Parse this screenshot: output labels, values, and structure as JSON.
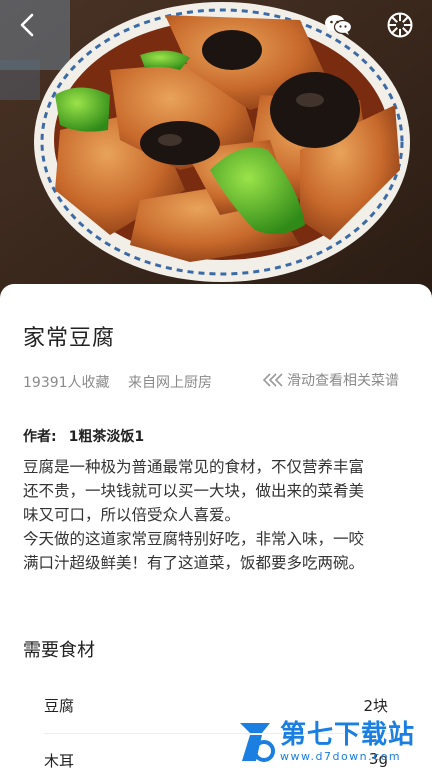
{
  "header": {
    "back_icon": "chevron-left-icon",
    "share_wechat_icon": "wechat-icon",
    "share_moments_icon": "moments-icon"
  },
  "recipe": {
    "title": "家常豆腐",
    "favorites": "19391人收藏",
    "source": "来自网上厨房",
    "swipe_hint": "滑动查看相关菜谱",
    "author_label": "作者:",
    "author_name": "1粗茶淡饭1",
    "description_lines": [
      "豆腐是一种极为普通最常见的食材，不仅营养丰富",
      "还不贵，一块钱就可以买一大块，做出来的菜肴美",
      "味又可口，所以倍受众人喜爱。",
      "今天做的这道家常豆腐特别好吃，非常入味，一咬",
      "满口汁超级鲜美！有了这道菜，饭都要多吃两碗。"
    ]
  },
  "ingredients": {
    "title": "需要食材",
    "items": [
      {
        "name": "豆腐",
        "amount": "2块"
      },
      {
        "name": "木耳",
        "amount": "3g"
      }
    ]
  },
  "watermark": {
    "name": "第七下载站",
    "url": "www.d7down.com"
  },
  "colors": {
    "watermark_blue": "#1a7fe0",
    "meta_gray": "#8a8a8a"
  }
}
